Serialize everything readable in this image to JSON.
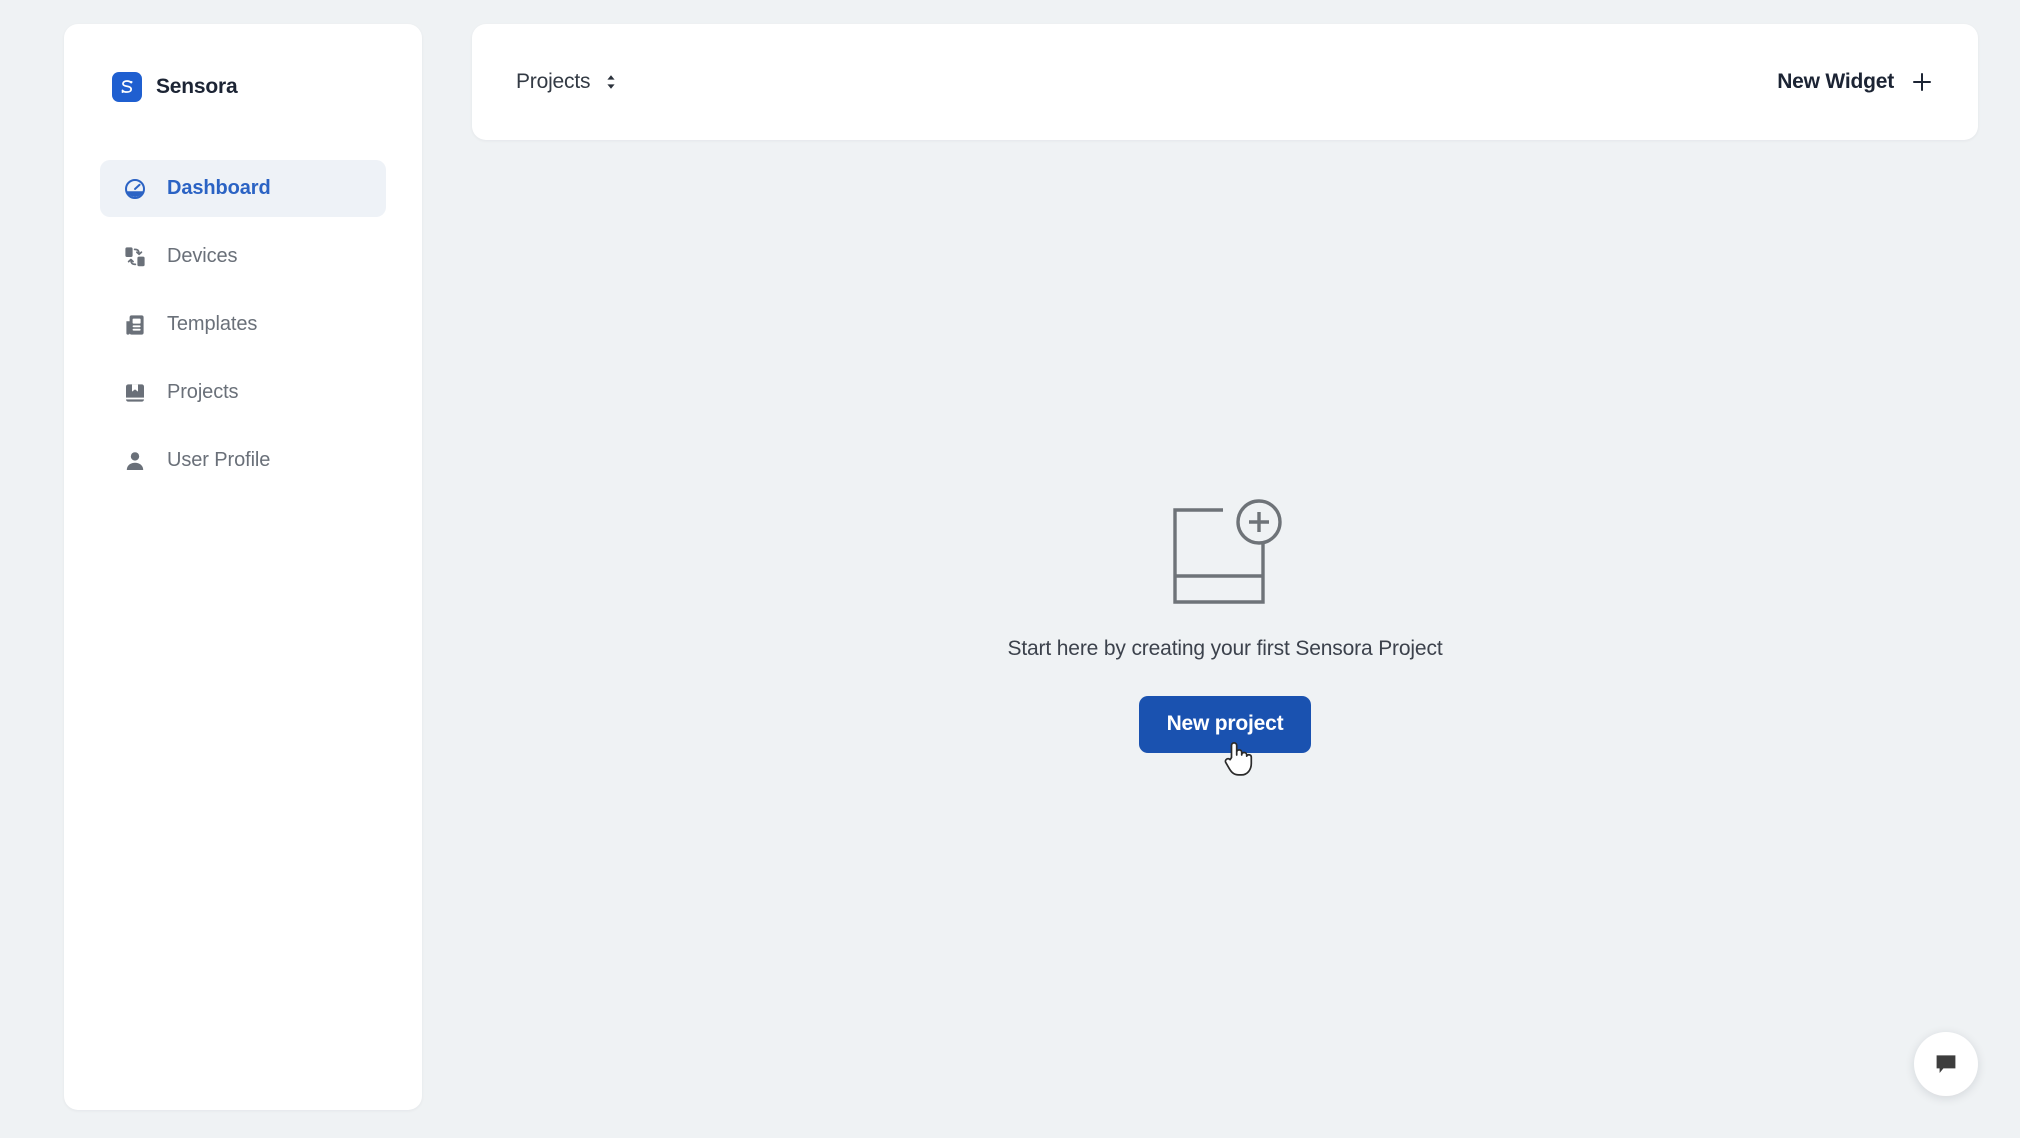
{
  "app": {
    "brand_name": "Sensora",
    "brand_icon": "sensora-logo-icon",
    "accent_color": "#1f5fd0",
    "primary_button_color": "#1a52b0",
    "background_color": "#eff2f4",
    "surface_color": "#ffffff"
  },
  "sidebar": {
    "items": [
      {
        "label": "Dashboard",
        "icon": "gauge-icon",
        "active": true
      },
      {
        "label": "Devices",
        "icon": "devices-icon",
        "active": false
      },
      {
        "label": "Templates",
        "icon": "template-icon",
        "active": false
      },
      {
        "label": "Projects",
        "icon": "book-icon",
        "active": false
      },
      {
        "label": "User Profile",
        "icon": "person-icon",
        "active": false
      }
    ]
  },
  "topbar": {
    "project_selector_label": "Projects",
    "project_selector_icon": "chevron-up-down-icon",
    "new_widget_label": "New Widget",
    "new_widget_icon": "plus-icon"
  },
  "empty_state": {
    "illustration_icon": "add-widget-illustration",
    "message": "Start here by creating your first Sensora Project",
    "button_label": "New project"
  },
  "chat": {
    "icon": "chat-bubble-icon"
  }
}
